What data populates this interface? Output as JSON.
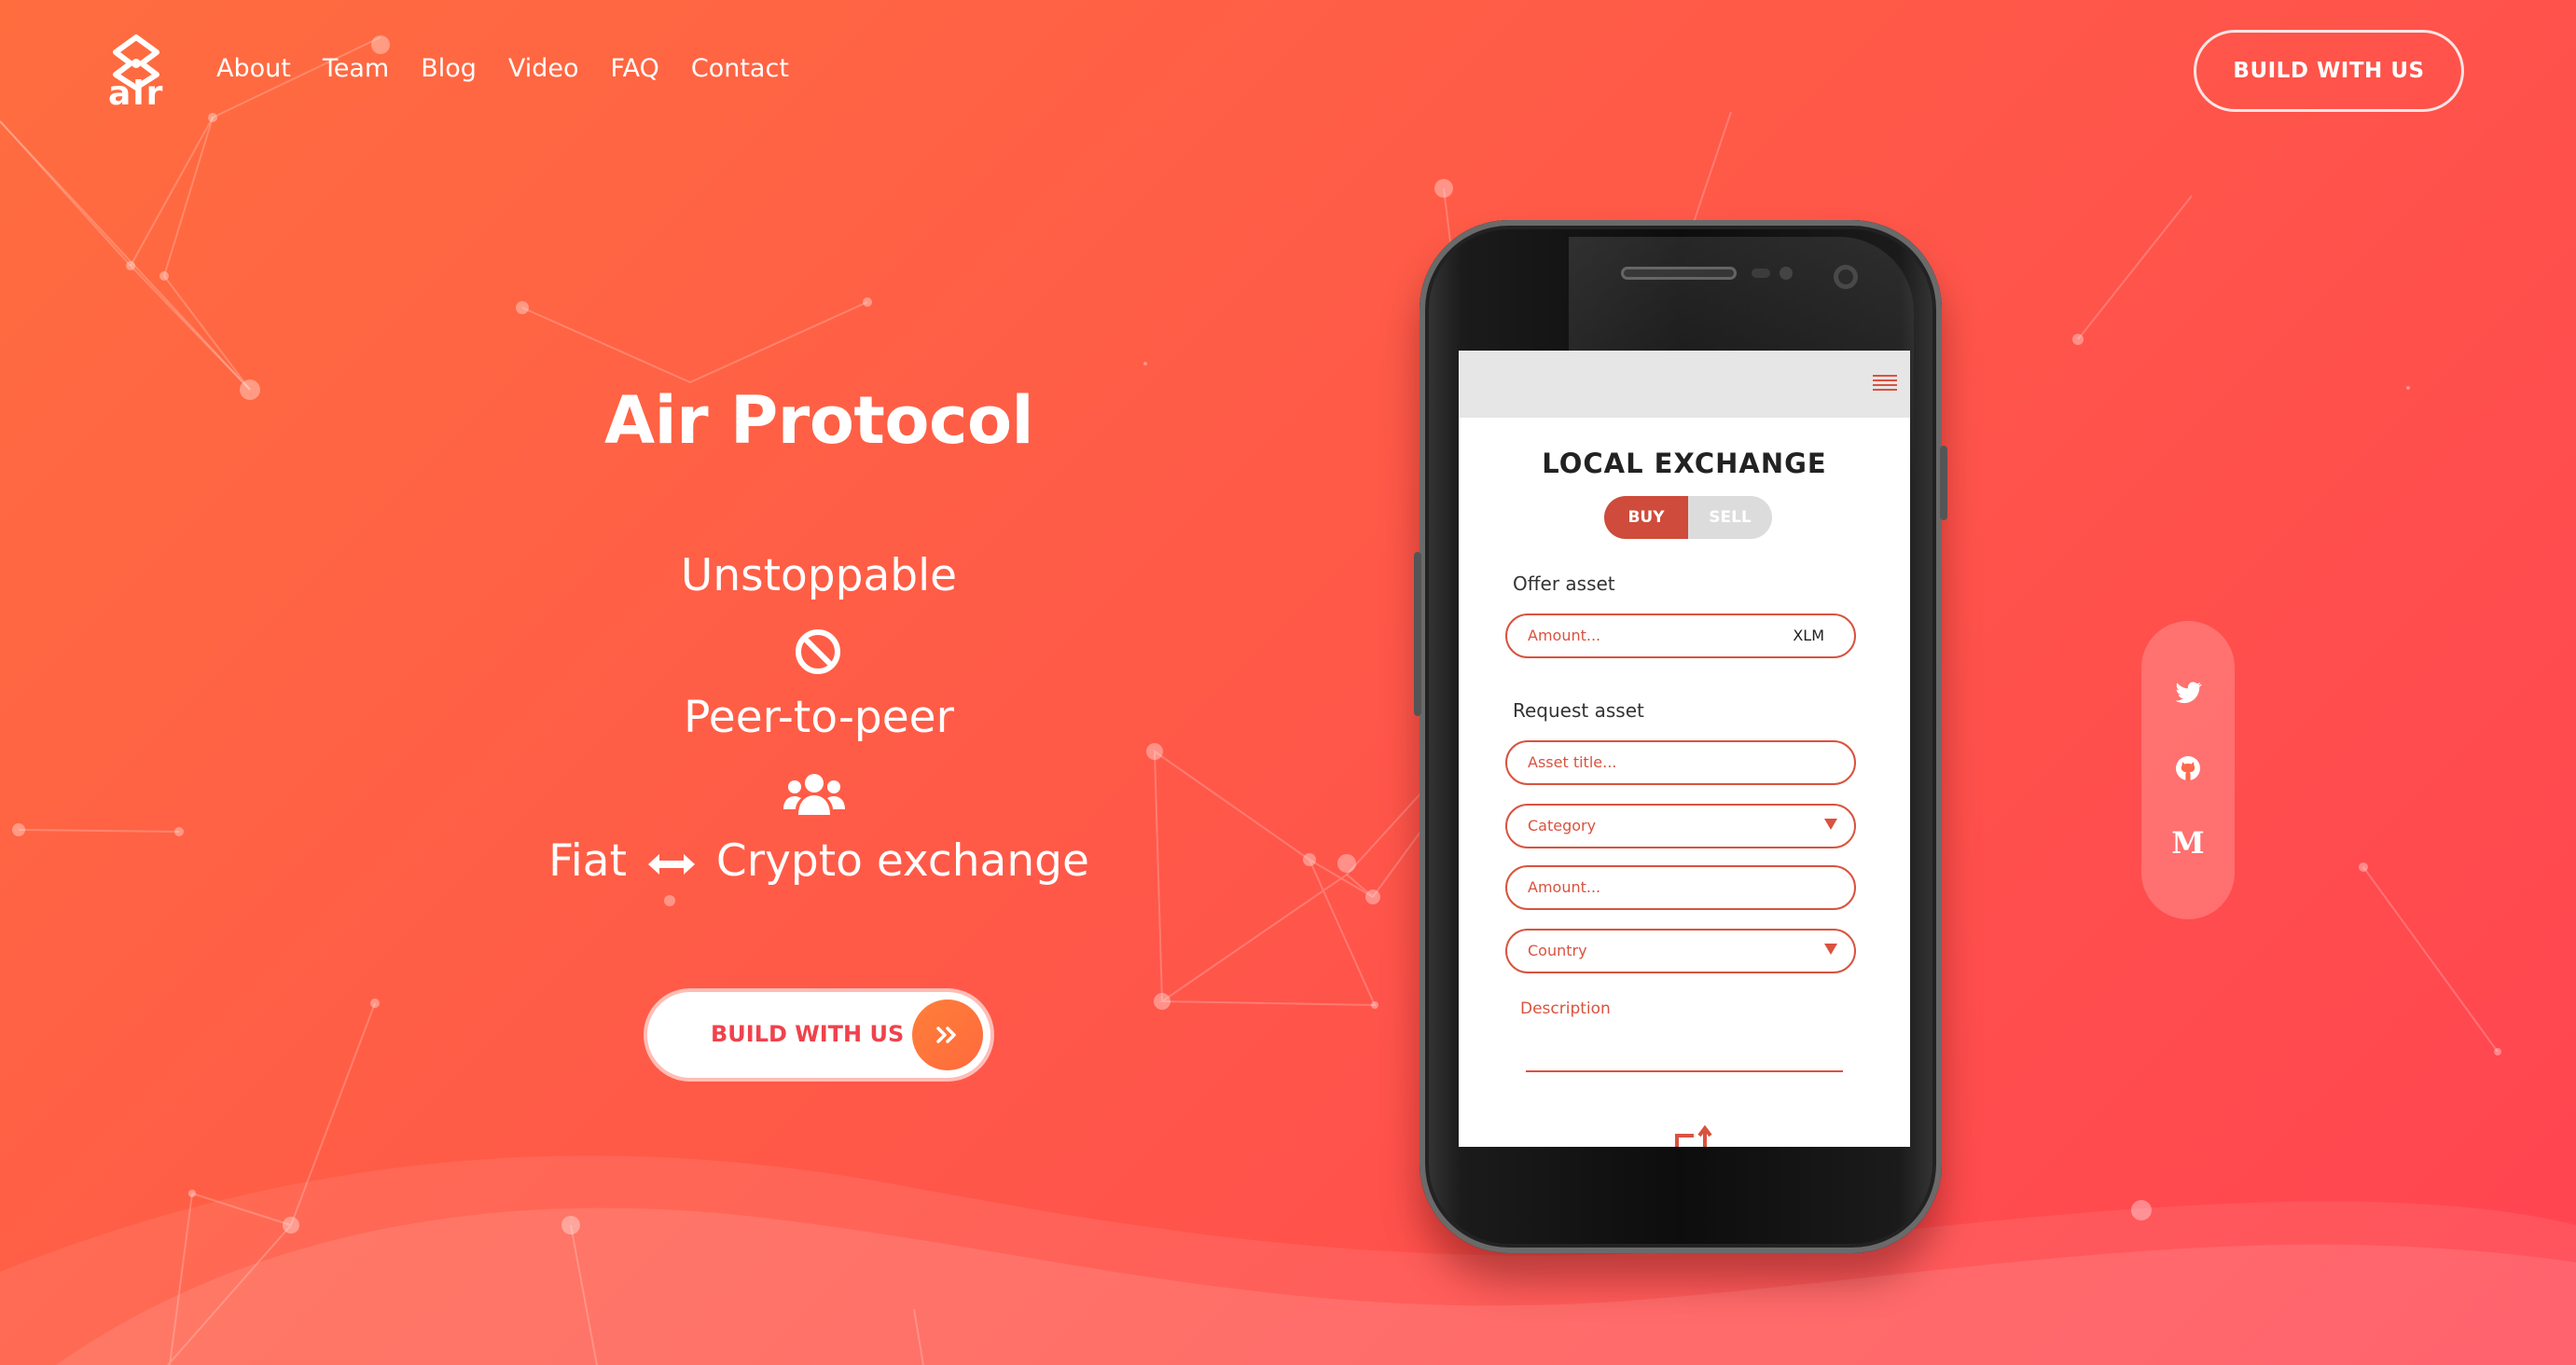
{
  "brand": {
    "logo_text": "air"
  },
  "nav": {
    "items": [
      {
        "label": "About"
      },
      {
        "label": "Team"
      },
      {
        "label": "Blog"
      },
      {
        "label": "Video"
      },
      {
        "label": "FAQ"
      },
      {
        "label": "Contact"
      }
    ],
    "cta_label": "BUILD WITH US"
  },
  "hero": {
    "title": "Air Protocol",
    "line1": "Unstoppable",
    "line1_icon": "ban-icon",
    "line2": "Peer-to-peer",
    "line2_icon": "users-icon",
    "line3_left": "Fiat",
    "line3_icon": "arrows-left-right-icon",
    "line3_right": "Crypto exchange",
    "cta_label": "BUILD WITH US",
    "cta_icon": "double-chevron-right-icon"
  },
  "phone": {
    "screen_title": "LOCAL EXCHANGE",
    "toggle": {
      "buy": "BUY",
      "sell": "SELL",
      "selected": "BUY"
    },
    "offer_label": "Offer asset",
    "offer_amount_placeholder": "Amount...",
    "offer_currency": "XLM",
    "request_label": "Request asset",
    "asset_title_placeholder": "Asset title...",
    "category_placeholder": "Category",
    "amount_placeholder": "Amount...",
    "country_placeholder": "Country",
    "description_label": "Description"
  },
  "social": {
    "items": [
      {
        "icon": "twitter-icon"
      },
      {
        "icon": "github-icon"
      },
      {
        "icon": "medium-icon",
        "glyph": "M"
      }
    ]
  },
  "colors": {
    "bg_start": "#ff6d3f",
    "bg_end": "#ff4451",
    "accent": "#d9533f",
    "cta_text": "#f0424c"
  }
}
